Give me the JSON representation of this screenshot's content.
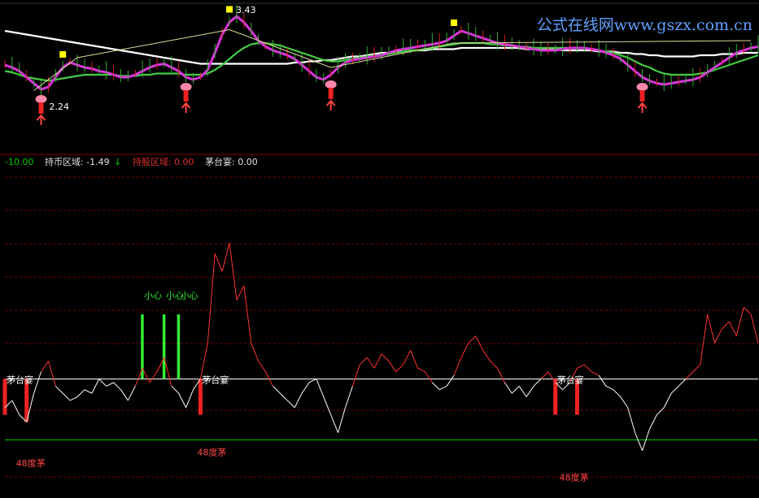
{
  "watermark": "公式在线网www.gszx.com.cn",
  "header": {
    "val1": "-10.00",
    "label1": "持币区域: -1.49",
    "arrow": "↓",
    "label2": "持股区域: 0.00",
    "label3": "茅台宴: 0.00"
  },
  "colors": {
    "bg": "#000000",
    "price_line": "#dd33dd",
    "ma_green": "#44cc44",
    "ma_white": "#ffffff",
    "signal_yellow": "#ffff00",
    "indicator_up": "#ff3333",
    "indicator_down": "#ffffff",
    "signal_bar_green": "#33ee33",
    "signal_bar_red": "#ee2222",
    "grid_red": "#7a0000",
    "baseline_white": "#ffffff",
    "baseline_green": "#00cc00"
  },
  "annotations": {
    "high_label": "3.43",
    "low_label": "2.24",
    "xiaoxin": "小心",
    "maotaiyan": "茅台宴",
    "du48": "48度茅"
  },
  "chart_data": [
    {
      "type": "line",
      "name": "price-panel",
      "series": [
        {
          "name": "price",
          "values": [
            60,
            58,
            55,
            50,
            45,
            40,
            42,
            50,
            58,
            62,
            60,
            58,
            57,
            55,
            54,
            52,
            50,
            50,
            52,
            55,
            58,
            60,
            61,
            58,
            55,
            50,
            48,
            50,
            56,
            70,
            85,
            95,
            100,
            95,
            88,
            80,
            75,
            72,
            70,
            68,
            65,
            60,
            55,
            50,
            48,
            52,
            58,
            62,
            64,
            65,
            66,
            67,
            68,
            70,
            72,
            73,
            74,
            75,
            76,
            77,
            78,
            80,
            84,
            88,
            86,
            84,
            82,
            80,
            78,
            77,
            76,
            75,
            74,
            73,
            72,
            72,
            72,
            73,
            74,
            74,
            74,
            73,
            72,
            70,
            68,
            65,
            60,
            55,
            50,
            47,
            45,
            44,
            45,
            46,
            47,
            48,
            50,
            54,
            58,
            62,
            66,
            70,
            72,
            74,
            75
          ]
        },
        {
          "name": "ma-green",
          "values": [
            55,
            54,
            52,
            50,
            49,
            48,
            47,
            48,
            49,
            50,
            51,
            52,
            52,
            52,
            52,
            52,
            51,
            51,
            51,
            52,
            52,
            53,
            53,
            53,
            53,
            52,
            52,
            52,
            53,
            56,
            60,
            65,
            70,
            74,
            77,
            78,
            78,
            77,
            76,
            74,
            72,
            70,
            68,
            66,
            64,
            63,
            63,
            64,
            65,
            66,
            67,
            68,
            68,
            69,
            70,
            71,
            72,
            72,
            73,
            74,
            75,
            76,
            77,
            78,
            78,
            78,
            78,
            77,
            77,
            76,
            76,
            75,
            75,
            74,
            74,
            74,
            74,
            74,
            74,
            74,
            74,
            73,
            72,
            71,
            70,
            68,
            66,
            63,
            60,
            58,
            55,
            53,
            52,
            52,
            52,
            52,
            53,
            54,
            56,
            58,
            60,
            62,
            64,
            66,
            68
          ]
        },
        {
          "name": "ma-white",
          "values": [
            88,
            87,
            86,
            85,
            84,
            83,
            82,
            81,
            80,
            79,
            78,
            77,
            76,
            75,
            74,
            73,
            72,
            71,
            70,
            69,
            68,
            67,
            66,
            65,
            64,
            63,
            62,
            61,
            61,
            61,
            61,
            61,
            61,
            61,
            61,
            61,
            61,
            61,
            61,
            61,
            62,
            62,
            63,
            63,
            64,
            64,
            65,
            66,
            67,
            67,
            68,
            69,
            70,
            70,
            71,
            71,
            72,
            72,
            72,
            73,
            73,
            73,
            73,
            74,
            74,
            74,
            74,
            74,
            74,
            74,
            74,
            74,
            73,
            73,
            73,
            73,
            73,
            72,
            72,
            72,
            72,
            72,
            71,
            71,
            71,
            70,
            70,
            69,
            69,
            68,
            68,
            67,
            67,
            67,
            67,
            67,
            68,
            68,
            68,
            69,
            69,
            69,
            70,
            70,
            70
          ]
        }
      ],
      "labels": [
        "3.43",
        "2.24"
      ]
    },
    {
      "type": "line",
      "name": "indicator-panel",
      "baselines": {
        "white": 0,
        "green": -17
      },
      "series": [
        {
          "name": "indicator",
          "values": [
            -8,
            -6,
            -10,
            -12,
            -4,
            2,
            5,
            -2,
            -4,
            -6,
            -5,
            -3,
            -4,
            0,
            -2,
            -1,
            -3,
            -6,
            -2,
            3,
            -1,
            2,
            6,
            -2,
            -4,
            -8,
            -3,
            0,
            10,
            35,
            30,
            38,
            22,
            26,
            10,
            5,
            2,
            -2,
            -4,
            -6,
            -8,
            -4,
            -1,
            0,
            -5,
            -10,
            -15,
            -8,
            -2,
            4,
            6,
            3,
            7,
            5,
            2,
            4,
            8,
            3,
            2,
            -1,
            -3,
            -2,
            1,
            6,
            10,
            12,
            8,
            5,
            3,
            -1,
            -4,
            -2,
            -5,
            -2,
            0,
            2,
            -1,
            -3,
            -1,
            3,
            4,
            2,
            1,
            -2,
            -3,
            -5,
            -8,
            -15,
            -20,
            -14,
            -10,
            -8,
            -4,
            -2,
            0,
            2,
            4,
            18,
            10,
            14,
            16,
            12,
            20,
            18,
            10
          ]
        }
      ],
      "signal_bars_green": [
        19,
        22,
        24
      ],
      "signal_bars_red": [
        0,
        3,
        27,
        76,
        79
      ],
      "labels": [
        "茅台宴",
        "48度茅",
        "小心"
      ]
    }
  ]
}
